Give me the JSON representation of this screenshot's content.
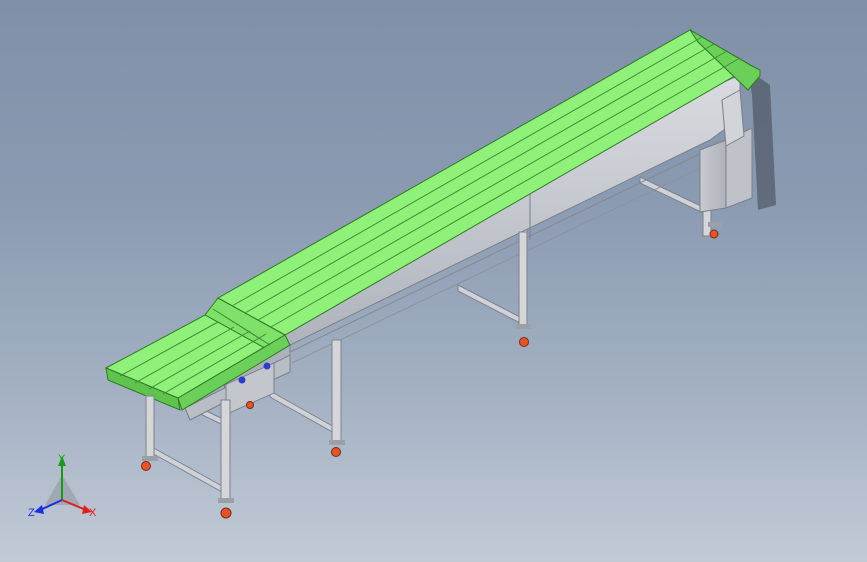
{
  "viewport": {
    "model": "belt-conveyor-isometric",
    "colors": {
      "belt": "#8ff07a",
      "belt_edge": "#2f7a22",
      "frame": "#c9ccd3",
      "frame_dark": "#8e939c",
      "leg": "#d4d6da",
      "caster_wheel": "#e2542c",
      "bolt": "#2b3ec9"
    }
  },
  "triad": {
    "x_label": "X",
    "y_label": "Y",
    "z_label": "Z",
    "x_color": "#e02020",
    "y_color": "#1a9a1a",
    "z_color": "#1c2ee0"
  }
}
